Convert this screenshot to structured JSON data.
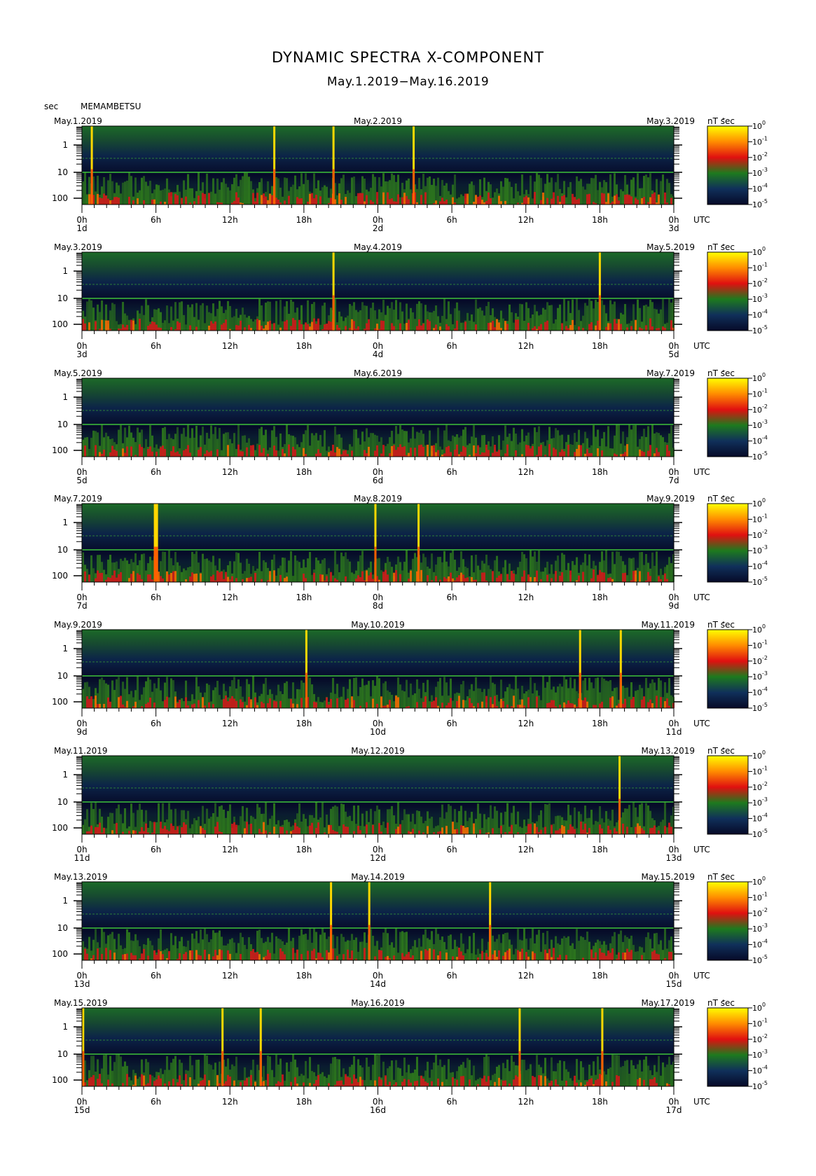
{
  "title": "DYNAMIC SPECTRA X-COMPONENT",
  "subtitle": "May.1.2019−May.16.2019",
  "y_unit_label": "sec",
  "station": "MEMAMBETSU",
  "colorbar_unit": "nT  sec",
  "colorbar_unit_sup": "2",
  "colorbar_ticks": [
    "10",
    "10",
    "10",
    "10",
    "10",
    "10"
  ],
  "colorbar_exponents": [
    "0",
    "-1",
    "-2",
    "-3",
    "-4",
    "-5"
  ],
  "colorbar_colors": [
    "#ffff00",
    "#ff8c00",
    "#e01010",
    "#1e7a1e",
    "#10305a",
    "#060a28"
  ],
  "utc_label": "UTC",
  "x_tick_labels": [
    "0h",
    "6h",
    "12h",
    "18h",
    "0h",
    "6h",
    "12h",
    "18h",
    "0h"
  ],
  "y_tick_labels": [
    "1",
    "10",
    "100"
  ],
  "panels": [
    {
      "date_left": "May.1.2019",
      "date_mid": "May.2.2019",
      "date_right": "May.3.2019",
      "day_left": "1d",
      "day_mid": "2d",
      "day_right": "3d",
      "spikes_hours": [
        0.8,
        15.6,
        20.4,
        26.9
      ]
    },
    {
      "date_left": "May.3.2019",
      "date_mid": "May.4.2019",
      "date_right": "May.5.2019",
      "day_left": "3d",
      "day_mid": "4d",
      "day_right": "5d",
      "spikes_hours": [
        20.4,
        42.0
      ]
    },
    {
      "date_left": "May.5.2019",
      "date_mid": "May.6.2019",
      "date_right": "May.7.2019",
      "day_left": "5d",
      "day_mid": "6d",
      "day_right": "7d",
      "spikes_hours": []
    },
    {
      "date_left": "May.7.2019",
      "date_mid": "May.8.2019",
      "date_right": "May.9.2019",
      "day_left": "7d",
      "day_mid": "8d",
      "day_right": "9d",
      "spikes_hours": [
        6.0,
        23.8,
        27.3
      ]
    },
    {
      "date_left": "May.9.2019",
      "date_mid": "May.10.2019",
      "date_right": "May.11.2019",
      "day_left": "9d",
      "day_mid": "10d",
      "day_right": "11d",
      "spikes_hours": [
        18.2,
        40.4,
        43.7
      ]
    },
    {
      "date_left": "May.11.2019",
      "date_mid": "May.12.2019",
      "date_right": "May.13.2019",
      "day_left": "11d",
      "day_mid": "12d",
      "day_right": "13d",
      "spikes_hours": [
        43.6
      ]
    },
    {
      "date_left": "May.13.2019",
      "date_mid": "May.14.2019",
      "date_right": "May.15.2019",
      "day_left": "13d",
      "day_mid": "14d",
      "day_right": "15d",
      "spikes_hours": [
        20.2,
        23.3,
        33.1
      ]
    },
    {
      "date_left": "May.15.2019",
      "date_mid": "May.16.2019",
      "date_right": "May.17.2019",
      "day_left": "15d",
      "day_mid": "16d",
      "day_right": "17d",
      "spikes_hours": [
        0.1,
        11.4,
        14.5,
        35.5,
        42.2
      ]
    }
  ],
  "chart_data": {
    "type": "heatmap",
    "title": "DYNAMIC SPECTRA X-COMPONENT",
    "subtitle": "May.1.2019−May.16.2019",
    "ylabel": "sec",
    "y_scale": "log",
    "y_ticks": [
      1,
      10,
      100
    ],
    "x_ticks_hours": [
      0,
      6,
      12,
      18,
      24,
      30,
      36,
      42,
      48
    ],
    "colorbar_label": "nT^2 sec",
    "colorbar_ticks": [
      "10^0",
      "10^-1",
      "10^-2",
      "10^-3",
      "10^-4",
      "10^-5"
    ],
    "panels_count": 8,
    "hours_per_panel": 48
  }
}
